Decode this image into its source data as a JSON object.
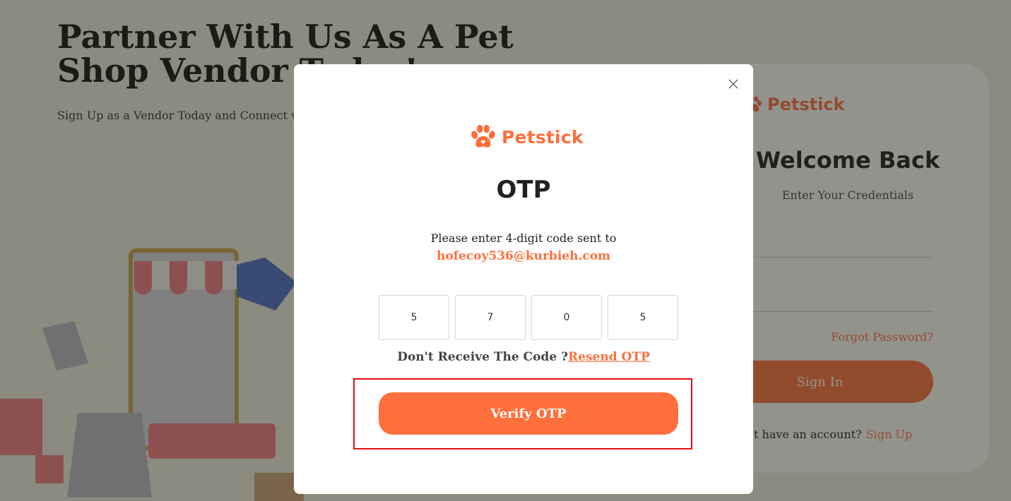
{
  "background": {
    "hero_title": "Partner With Us As A Pet Shop Vendor Today!",
    "hero_subtitle": "Sign Up as a Vendor Today and Connect with",
    "login_card": {
      "brand": "Petstick",
      "title": "Welcome Back",
      "subtitle": "Enter Your Credentials",
      "forgot_password": "Forgot Password?",
      "sign_in": "Sign In",
      "account_prompt": "Don't have an account?",
      "sign_up": "Sign Up"
    }
  },
  "modal": {
    "brand": "Petstick",
    "title": "OTP",
    "instruction": "Please enter 4-digit code sent to",
    "email": "hofecoy536@kurbieh.com",
    "otp_digits": [
      "5",
      "7",
      "0",
      "5"
    ],
    "resend_prompt": "Don't Receive The Code ?",
    "resend_link": "Resend OTP",
    "verify_label": "Verify OTP"
  },
  "colors": {
    "accent": "#ff6f3c",
    "highlight": "#e01010"
  },
  "icons": {
    "close": "close-icon",
    "brand": "paw-icon"
  }
}
